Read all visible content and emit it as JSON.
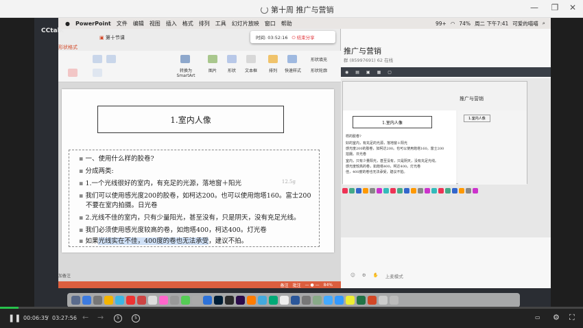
{
  "window": {
    "title": "第十周 推广与营销"
  },
  "cctalk_label": "CCtalk",
  "mac_menubar": {
    "apple": "",
    "items": [
      "PowerPoint",
      "文件",
      "编辑",
      "视图",
      "插入",
      "格式",
      "排列",
      "工具",
      "幻灯片放映",
      "窗口",
      "帮助"
    ],
    "right": {
      "badge": "99+",
      "battery": "74%",
      "datetime": "周二 下午7:41",
      "user": "可爱的喵喵"
    }
  },
  "recording": {
    "label": "时间: 03:52:16",
    "stop_label": "结束分享"
  },
  "ppt": {
    "tab_label": "第十节课",
    "format_label": "形状格式",
    "ribbon": {
      "convert_label": "转换为 SmartArt",
      "picture_label": "图片",
      "shape_label": "形状",
      "textbox_label": "文本框",
      "arrange_label": "排列",
      "quickstyle_label": "快速样式",
      "fill_label": "形状填充",
      "outline_label": "形状轮廓"
    },
    "slide": {
      "title": "1.室内人像",
      "annotation": "12.5g",
      "lines": [
        "一、使用什么样的胶卷?",
        "分成两类:",
        "1.一个光线很好的室内，有充足的光源，落地窗＋阳光",
        "我们可以使用感光度200的胶卷，如柯达200。也可以使用炮塔160。富士200",
        "不要在室内拍摄。日光卷",
        "2.光线不佳的室内，只有少量阳光，甚至没有，只是阴天，没有充足光线。",
        "我们必须使用感光度较高的卷，如炮塔400，柯达400。灯光卷"
      ],
      "last_line": {
        "prefix": "如果",
        "highlight": "光线实在不佳，400度的卷也无法承受",
        "suffix": "，建议不拍。"
      }
    },
    "notes_label": "加备注",
    "status": {
      "notes": "备注",
      "comments": "批注",
      "zoom": "84%"
    }
  },
  "cctalk_pane": {
    "room_title": "推广与营销",
    "room_sub": "群 (85997691)  62 在线",
    "mini_title": "1.室内人像",
    "mini_lines": [
      "样的胶卷?",
      "好的室内，有充足的光源，落地窗＋阳光",
      "感光度200的胶卷，如柯达200。也可以使用炮塔160。富士200",
      "拍摄。日光卷",
      "室内，只有少量阳光，甚至没有，只是阴天，没有充足光线。",
      "感光度较高的卷，如炮塔400，柯达400。灯光卷",
      "佳，400度的卷也无法承受，建议不拍。"
    ],
    "sidebar_item": "1.室内人像",
    "mode_label": "上麦模式"
  },
  "player": {
    "current": "00:06:35",
    "total": "03:27:56",
    "progress": 0.032
  }
}
